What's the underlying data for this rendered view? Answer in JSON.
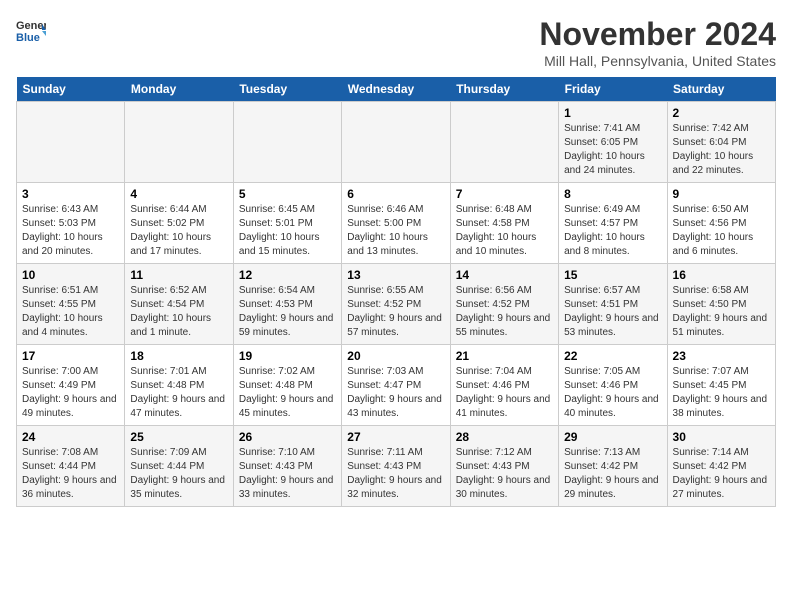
{
  "logo": {
    "general": "General",
    "blue": "Blue"
  },
  "title": "November 2024",
  "location": "Mill Hall, Pennsylvania, United States",
  "days_of_week": [
    "Sunday",
    "Monday",
    "Tuesday",
    "Wednesday",
    "Thursday",
    "Friday",
    "Saturday"
  ],
  "weeks": [
    [
      {
        "day": "",
        "sunrise": "",
        "sunset": "",
        "daylight": ""
      },
      {
        "day": "",
        "sunrise": "",
        "sunset": "",
        "daylight": ""
      },
      {
        "day": "",
        "sunrise": "",
        "sunset": "",
        "daylight": ""
      },
      {
        "day": "",
        "sunrise": "",
        "sunset": "",
        "daylight": ""
      },
      {
        "day": "",
        "sunrise": "",
        "sunset": "",
        "daylight": ""
      },
      {
        "day": "1",
        "sunrise": "Sunrise: 7:41 AM",
        "sunset": "Sunset: 6:05 PM",
        "daylight": "Daylight: 10 hours and 24 minutes."
      },
      {
        "day": "2",
        "sunrise": "Sunrise: 7:42 AM",
        "sunset": "Sunset: 6:04 PM",
        "daylight": "Daylight: 10 hours and 22 minutes."
      }
    ],
    [
      {
        "day": "3",
        "sunrise": "Sunrise: 6:43 AM",
        "sunset": "Sunset: 5:03 PM",
        "daylight": "Daylight: 10 hours and 20 minutes."
      },
      {
        "day": "4",
        "sunrise": "Sunrise: 6:44 AM",
        "sunset": "Sunset: 5:02 PM",
        "daylight": "Daylight: 10 hours and 17 minutes."
      },
      {
        "day": "5",
        "sunrise": "Sunrise: 6:45 AM",
        "sunset": "Sunset: 5:01 PM",
        "daylight": "Daylight: 10 hours and 15 minutes."
      },
      {
        "day": "6",
        "sunrise": "Sunrise: 6:46 AM",
        "sunset": "Sunset: 5:00 PM",
        "daylight": "Daylight: 10 hours and 13 minutes."
      },
      {
        "day": "7",
        "sunrise": "Sunrise: 6:48 AM",
        "sunset": "Sunset: 4:58 PM",
        "daylight": "Daylight: 10 hours and 10 minutes."
      },
      {
        "day": "8",
        "sunrise": "Sunrise: 6:49 AM",
        "sunset": "Sunset: 4:57 PM",
        "daylight": "Daylight: 10 hours and 8 minutes."
      },
      {
        "day": "9",
        "sunrise": "Sunrise: 6:50 AM",
        "sunset": "Sunset: 4:56 PM",
        "daylight": "Daylight: 10 hours and 6 minutes."
      }
    ],
    [
      {
        "day": "10",
        "sunrise": "Sunrise: 6:51 AM",
        "sunset": "Sunset: 4:55 PM",
        "daylight": "Daylight: 10 hours and 4 minutes."
      },
      {
        "day": "11",
        "sunrise": "Sunrise: 6:52 AM",
        "sunset": "Sunset: 4:54 PM",
        "daylight": "Daylight: 10 hours and 1 minute."
      },
      {
        "day": "12",
        "sunrise": "Sunrise: 6:54 AM",
        "sunset": "Sunset: 4:53 PM",
        "daylight": "Daylight: 9 hours and 59 minutes."
      },
      {
        "day": "13",
        "sunrise": "Sunrise: 6:55 AM",
        "sunset": "Sunset: 4:52 PM",
        "daylight": "Daylight: 9 hours and 57 minutes."
      },
      {
        "day": "14",
        "sunrise": "Sunrise: 6:56 AM",
        "sunset": "Sunset: 4:52 PM",
        "daylight": "Daylight: 9 hours and 55 minutes."
      },
      {
        "day": "15",
        "sunrise": "Sunrise: 6:57 AM",
        "sunset": "Sunset: 4:51 PM",
        "daylight": "Daylight: 9 hours and 53 minutes."
      },
      {
        "day": "16",
        "sunrise": "Sunrise: 6:58 AM",
        "sunset": "Sunset: 4:50 PM",
        "daylight": "Daylight: 9 hours and 51 minutes."
      }
    ],
    [
      {
        "day": "17",
        "sunrise": "Sunrise: 7:00 AM",
        "sunset": "Sunset: 4:49 PM",
        "daylight": "Daylight: 9 hours and 49 minutes."
      },
      {
        "day": "18",
        "sunrise": "Sunrise: 7:01 AM",
        "sunset": "Sunset: 4:48 PM",
        "daylight": "Daylight: 9 hours and 47 minutes."
      },
      {
        "day": "19",
        "sunrise": "Sunrise: 7:02 AM",
        "sunset": "Sunset: 4:48 PM",
        "daylight": "Daylight: 9 hours and 45 minutes."
      },
      {
        "day": "20",
        "sunrise": "Sunrise: 7:03 AM",
        "sunset": "Sunset: 4:47 PM",
        "daylight": "Daylight: 9 hours and 43 minutes."
      },
      {
        "day": "21",
        "sunrise": "Sunrise: 7:04 AM",
        "sunset": "Sunset: 4:46 PM",
        "daylight": "Daylight: 9 hours and 41 minutes."
      },
      {
        "day": "22",
        "sunrise": "Sunrise: 7:05 AM",
        "sunset": "Sunset: 4:46 PM",
        "daylight": "Daylight: 9 hours and 40 minutes."
      },
      {
        "day": "23",
        "sunrise": "Sunrise: 7:07 AM",
        "sunset": "Sunset: 4:45 PM",
        "daylight": "Daylight: 9 hours and 38 minutes."
      }
    ],
    [
      {
        "day": "24",
        "sunrise": "Sunrise: 7:08 AM",
        "sunset": "Sunset: 4:44 PM",
        "daylight": "Daylight: 9 hours and 36 minutes."
      },
      {
        "day": "25",
        "sunrise": "Sunrise: 7:09 AM",
        "sunset": "Sunset: 4:44 PM",
        "daylight": "Daylight: 9 hours and 35 minutes."
      },
      {
        "day": "26",
        "sunrise": "Sunrise: 7:10 AM",
        "sunset": "Sunset: 4:43 PM",
        "daylight": "Daylight: 9 hours and 33 minutes."
      },
      {
        "day": "27",
        "sunrise": "Sunrise: 7:11 AM",
        "sunset": "Sunset: 4:43 PM",
        "daylight": "Daylight: 9 hours and 32 minutes."
      },
      {
        "day": "28",
        "sunrise": "Sunrise: 7:12 AM",
        "sunset": "Sunset: 4:43 PM",
        "daylight": "Daylight: 9 hours and 30 minutes."
      },
      {
        "day": "29",
        "sunrise": "Sunrise: 7:13 AM",
        "sunset": "Sunset: 4:42 PM",
        "daylight": "Daylight: 9 hours and 29 minutes."
      },
      {
        "day": "30",
        "sunrise": "Sunrise: 7:14 AM",
        "sunset": "Sunset: 4:42 PM",
        "daylight": "Daylight: 9 hours and 27 minutes."
      }
    ]
  ]
}
